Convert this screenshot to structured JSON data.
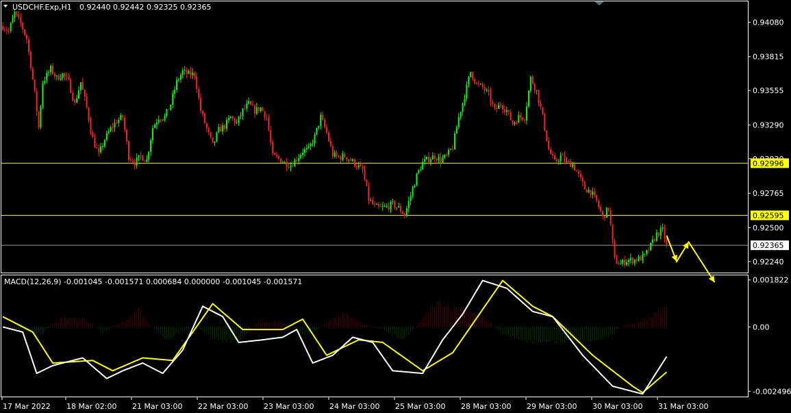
{
  "header": {
    "symbol": "USDCHF.Exp,H1",
    "quote": "0.92440 0.92442 0.92325 0.92365"
  },
  "macd_header": {
    "label": "MACD(12,26,9) -0.001045 -0.001571 0.000684 0.000000 -0.001045 -0.001571"
  },
  "colors": {
    "background": "#000000",
    "bull": "#00ff00",
    "bear": "#ff2020",
    "hline": "#ffff00",
    "current": "#ffffff",
    "macd_line": "#ffffff",
    "signal_line": "#ffff00",
    "hist_pos": "#8b0000",
    "hist_neg": "#006400",
    "arrow": "#ffff00"
  },
  "chart_data": [
    {
      "type": "candlestick",
      "symbol": "USDCHF.Exp,H1",
      "ylim": [
        0.92155,
        0.9424
      ],
      "y_ticks": [
        "0.94080",
        "0.93815",
        "0.93555",
        "0.93290",
        "0.93030",
        "0.92765",
        "0.92500",
        "0.92240"
      ],
      "x_ticks": [
        "17 Mar 2022",
        "18 Mar 02:00",
        "21 Mar 03:00",
        "22 Mar 03:00",
        "23 Mar 03:00",
        "24 Mar 03:00",
        "25 Mar 03:00",
        "28 Mar 03:00",
        "29 Mar 03:00",
        "30 Mar 03:00",
        "31 Mar 03:00"
      ],
      "price_levels": [
        {
          "value": 0.92996,
          "label": "0.92996"
        },
        {
          "value": 0.92595,
          "label": "0.92595"
        }
      ],
      "current_price": {
        "value": 0.92365,
        "label": "0.92365"
      },
      "close_anchors": [
        [
          0,
          0.9405
        ],
        [
          3,
          0.9401
        ],
        [
          6,
          0.9415
        ],
        [
          9,
          0.9407
        ],
        [
          12,
          0.9395
        ],
        [
          14,
          0.9375
        ],
        [
          16,
          0.9353
        ],
        [
          18,
          0.9327
        ],
        [
          20,
          0.9362
        ],
        [
          24,
          0.9372
        ],
        [
          27,
          0.9365
        ],
        [
          30,
          0.9368
        ],
        [
          33,
          0.9362
        ],
        [
          36,
          0.9345
        ],
        [
          39,
          0.9362
        ],
        [
          42,
          0.9342
        ],
        [
          45,
          0.9318
        ],
        [
          48,
          0.9306
        ],
        [
          51,
          0.9318
        ],
        [
          54,
          0.9326
        ],
        [
          57,
          0.9332
        ],
        [
          60,
          0.9335
        ],
        [
          63,
          0.9305
        ],
        [
          66,
          0.93
        ],
        [
          69,
          0.9305
        ],
        [
          72,
          0.9302
        ],
        [
          75,
          0.9327
        ],
        [
          78,
          0.9335
        ],
        [
          81,
          0.9335
        ],
        [
          84,
          0.9345
        ],
        [
          87,
          0.9362
        ],
        [
          90,
          0.937
        ],
        [
          93,
          0.9368
        ],
        [
          96,
          0.9368
        ],
        [
          99,
          0.934
        ],
        [
          102,
          0.9326
        ],
        [
          105,
          0.9313
        ],
        [
          108,
          0.9325
        ],
        [
          111,
          0.9328
        ],
        [
          114,
          0.9335
        ],
        [
          117,
          0.933
        ],
        [
          120,
          0.934
        ],
        [
          123,
          0.9345
        ],
        [
          126,
          0.934
        ],
        [
          129,
          0.9342
        ],
        [
          132,
          0.9335
        ],
        [
          135,
          0.9305
        ],
        [
          138,
          0.9303
        ],
        [
          141,
          0.93
        ],
        [
          144,
          0.9298
        ],
        [
          147,
          0.9303
        ],
        [
          150,
          0.9309
        ],
        [
          153,
          0.931
        ],
        [
          156,
          0.932
        ],
        [
          159,
          0.9335
        ],
        [
          162,
          0.9323
        ],
        [
          165,
          0.9306
        ],
        [
          168,
          0.9304
        ],
        [
          171,
          0.9305
        ],
        [
          174,
          0.9302
        ],
        [
          177,
          0.9298
        ],
        [
          180,
          0.9294
        ],
        [
          183,
          0.9272
        ],
        [
          186,
          0.9266
        ],
        [
          189,
          0.9265
        ],
        [
          192,
          0.9266
        ],
        [
          195,
          0.9268
        ],
        [
          198,
          0.9265
        ],
        [
          201,
          0.926
        ],
        [
          204,
          0.9275
        ],
        [
          207,
          0.929
        ],
        [
          210,
          0.93
        ],
        [
          213,
          0.9303
        ],
        [
          216,
          0.9305
        ],
        [
          219,
          0.9302
        ],
        [
          222,
          0.9305
        ],
        [
          225,
          0.9312
        ],
        [
          228,
          0.9335
        ],
        [
          231,
          0.9352
        ],
        [
          234,
          0.937
        ],
        [
          237,
          0.936
        ],
        [
          240,
          0.9358
        ],
        [
          243,
          0.9352
        ],
        [
          246,
          0.934
        ],
        [
          249,
          0.9345
        ],
        [
          252,
          0.934
        ],
        [
          255,
          0.933
        ],
        [
          258,
          0.9335
        ],
        [
          261,
          0.9335
        ],
        [
          264,
          0.9365
        ],
        [
          267,
          0.9355
        ],
        [
          270,
          0.9335
        ],
        [
          273,
          0.931
        ],
        [
          276,
          0.93
        ],
        [
          279,
          0.9305
        ],
        [
          282,
          0.93
        ],
        [
          285,
          0.9299
        ],
        [
          288,
          0.929
        ],
        [
          291,
          0.928
        ],
        [
          294,
          0.9278
        ],
        [
          297,
          0.927
        ],
        [
          300,
          0.9258
        ],
        [
          303,
          0.9265
        ],
        [
          306,
          0.9225
        ],
        [
          309,
          0.9222
        ],
        [
          312,
          0.9225
        ],
        [
          315,
          0.9225
        ],
        [
          318,
          0.9226
        ],
        [
          321,
          0.9228
        ],
        [
          324,
          0.9236
        ],
        [
          327,
          0.9245
        ],
        [
          330,
          0.9248
        ],
        [
          332,
          0.92365
        ]
      ],
      "forecast_arrow_prices": [
        0.9244,
        0.9224,
        0.9239,
        0.9208
      ],
      "forecast_arrow_bar_positions": [
        332,
        337,
        343,
        356
      ]
    },
    {
      "type": "macd",
      "title": "MACD(12,26,9) -0.001045 -0.001571 0.000684 0.000000 -0.001045 -0.001571",
      "ylim": [
        -0.0027,
        0.002
      ],
      "y_ticks": [
        "0.001822",
        "0.00",
        "-0.002496"
      ],
      "series": [
        {
          "role": "macd_line",
          "points": [
            [
              0,
              0.0
            ],
            [
              10,
              -0.0002
            ],
            [
              17,
              -0.0018
            ],
            [
              25,
              -0.0015
            ],
            [
              40,
              -0.0012
            ],
            [
              52,
              -0.002
            ],
            [
              60,
              -0.0017
            ],
            [
              70,
              -0.0014
            ],
            [
              80,
              -0.0018
            ],
            [
              90,
              -0.0009
            ],
            [
              100,
              0.0008
            ],
            [
              110,
              0.0004
            ],
            [
              118,
              -0.0006
            ],
            [
              130,
              -0.0005
            ],
            [
              140,
              -0.0004
            ],
            [
              147,
              -0.0001
            ],
            [
              155,
              -0.0014
            ],
            [
              165,
              -0.0011
            ],
            [
              175,
              -0.0004
            ],
            [
              185,
              -0.0006
            ],
            [
              195,
              -0.0017
            ],
            [
              210,
              -0.0018
            ],
            [
              220,
              -0.0005
            ],
            [
              230,
              0.0005
            ],
            [
              240,
              0.0018
            ],
            [
              252,
              0.0015
            ],
            [
              265,
              0.0006
            ],
            [
              275,
              0.0004
            ],
            [
              290,
              -0.0011
            ],
            [
              305,
              -0.0023
            ],
            [
              320,
              -0.0026
            ],
            [
              332,
              -0.00115
            ]
          ]
        },
        {
          "role": "signal_line",
          "points": [
            [
              0,
              0.0004
            ],
            [
              15,
              -0.0002
            ],
            [
              25,
              -0.0014
            ],
            [
              45,
              -0.0013
            ],
            [
              55,
              -0.0017
            ],
            [
              70,
              -0.0012
            ],
            [
              85,
              -0.0013
            ],
            [
              105,
              0.0009
            ],
            [
              120,
              -0.0001
            ],
            [
              140,
              -0.0001
            ],
            [
              150,
              0.0003
            ],
            [
              162,
              -0.0011
            ],
            [
              178,
              -0.0005
            ],
            [
              190,
              -0.0006
            ],
            [
              210,
              -0.0017
            ],
            [
              225,
              -0.001
            ],
            [
              250,
              0.0018
            ],
            [
              265,
              0.0008
            ],
            [
              275,
              0.0004
            ],
            [
              295,
              -0.0011
            ],
            [
              315,
              -0.0023
            ],
            [
              320,
              -0.00255
            ],
            [
              332,
              -0.00175
            ]
          ]
        }
      ],
      "histogram_anchors": [
        [
          0,
          0.0
        ],
        [
          20,
          -0.0003
        ],
        [
          28,
          0.00035
        ],
        [
          40,
          0.00035
        ],
        [
          50,
          -0.0002
        ],
        [
          63,
          0.0003
        ],
        [
          68,
          0.0007
        ],
        [
          72,
          0.0002
        ],
        [
          82,
          -0.0005
        ],
        [
          95,
          0.0
        ],
        [
          108,
          -0.0005
        ],
        [
          118,
          -0.0006
        ],
        [
          128,
          0.00025
        ],
        [
          140,
          0.0002
        ],
        [
          150,
          -0.0003
        ],
        [
          158,
          -0.0001
        ],
        [
          165,
          0.00035
        ],
        [
          172,
          0.00055
        ],
        [
          180,
          0.0001
        ],
        [
          190,
          -0.0001
        ],
        [
          200,
          -0.0005
        ],
        [
          208,
          0.00015
        ],
        [
          217,
          0.00095
        ],
        [
          230,
          0.0007
        ],
        [
          240,
          0.0004
        ],
        [
          250,
          -0.0003
        ],
        [
          265,
          -0.0006
        ],
        [
          280,
          -0.00055
        ],
        [
          290,
          -0.0006
        ],
        [
          300,
          -0.0005
        ],
        [
          310,
          5e-05
        ],
        [
          320,
          0.00025
        ],
        [
          332,
          0.00075
        ]
      ]
    }
  ]
}
